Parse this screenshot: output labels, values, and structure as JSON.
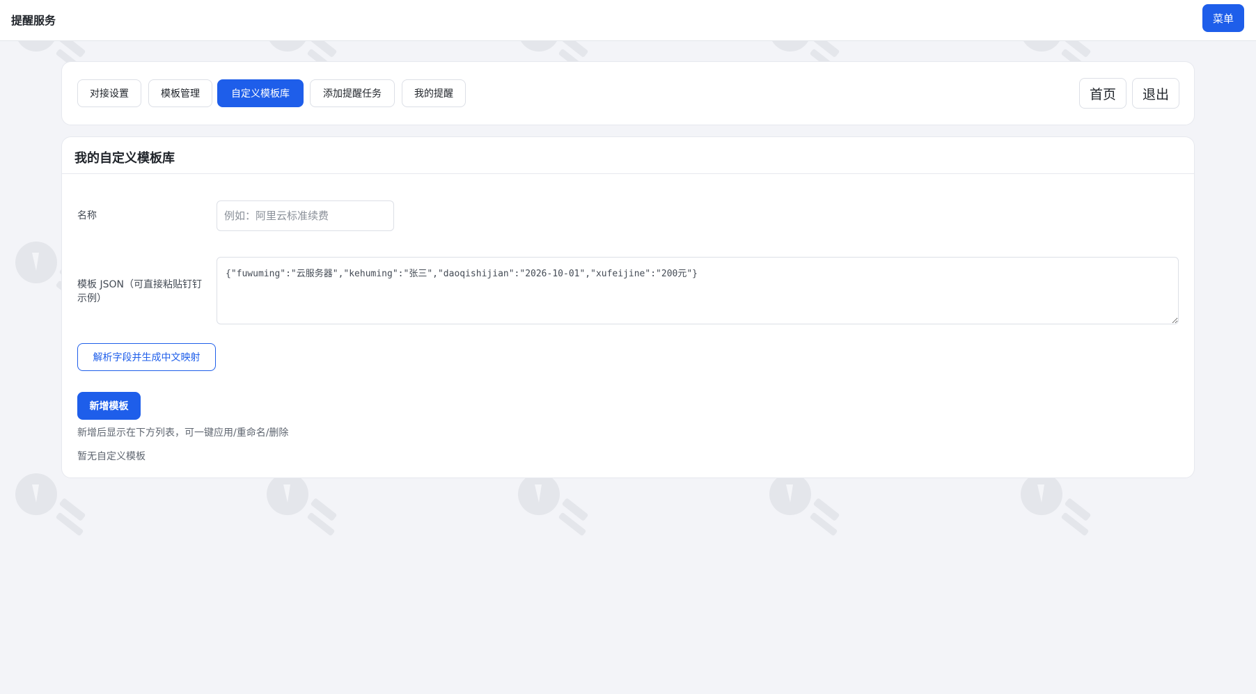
{
  "header": {
    "app_title": "提醒服务",
    "menu_label": "菜单"
  },
  "nav": {
    "tabs": [
      {
        "label": "对接设置",
        "active": false
      },
      {
        "label": "模板管理",
        "active": false
      },
      {
        "label": "自定义模板库",
        "active": true
      },
      {
        "label": "添加提醒任务",
        "active": false
      },
      {
        "label": "我的提醒",
        "active": false
      }
    ],
    "home_label": "首页",
    "logout_label": "退出"
  },
  "main": {
    "title": "我的自定义模板库",
    "name_label": "名称",
    "name_placeholder": "例如：阿里云标准续费",
    "name_value": "",
    "json_label": "模板 JSON（可直接粘贴钉钉示例）",
    "json_value": "{\"fuwuming\":\"云服务器\",\"kehuming\":\"张三\",\"daoqishijian\":\"2026-10-01\",\"xufeijine\":\"200元\"}",
    "parse_button": "解析字段并生成中文映射",
    "add_button": "新增模板",
    "hint": "新增后显示在下方列表，可一键应用/重命名/删除",
    "empty_text": "暂无自定义模板"
  },
  "colors": {
    "accent": "#1e5eea",
    "background": "#f3f4f8",
    "card": "#ffffff"
  }
}
